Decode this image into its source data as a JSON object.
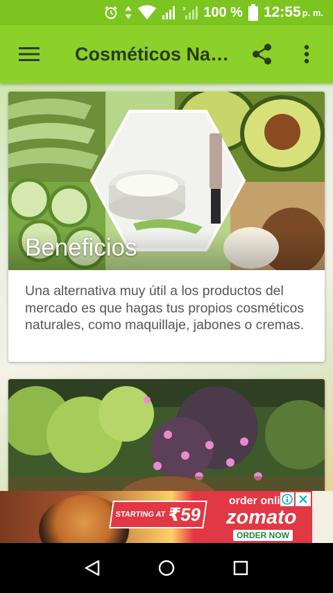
{
  "status_bar": {
    "battery_percent": "100 %",
    "time": "12:55",
    "ampm": "p. m.",
    "icons": [
      "alarm-icon",
      "data-arrows-icon",
      "wifi-icon",
      "signal-icon",
      "signal-x-icon",
      "battery-icon"
    ]
  },
  "app_bar": {
    "title": "Cosméticos Na…",
    "icons": {
      "menu": "hamburger-menu-icon",
      "share": "share-icon",
      "more": "more-vert-icon"
    },
    "color": "#8bd12a"
  },
  "cards": [
    {
      "title": "Beneficios",
      "description": "Una alternativa muy útil a los productos del mercado es que hagas tus propios cosméticos naturales, como maquillaje, jabones o cremas."
    },
    {
      "title": "",
      "description": ""
    }
  ],
  "ad": {
    "price_prefix": "STARTING AT",
    "price": "₹59",
    "order_online": "order online",
    "brand": "zomato",
    "cta": "ORDER NOW",
    "accent": "#e23744"
  },
  "theme": {
    "status_color": "#7cc520",
    "text_gray": "#555555"
  }
}
